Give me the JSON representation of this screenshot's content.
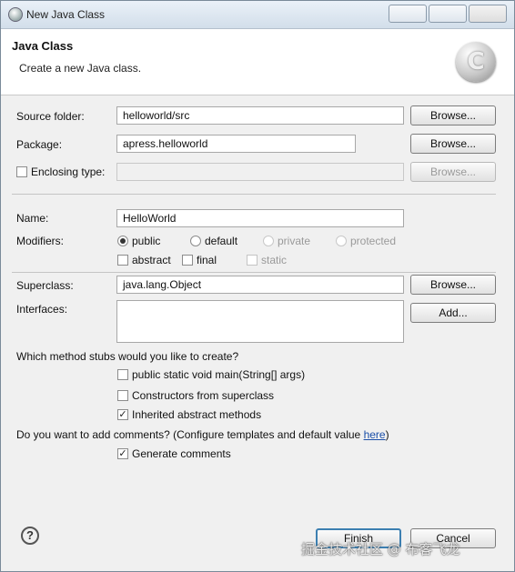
{
  "window": {
    "title": "New Java Class"
  },
  "header": {
    "title": "Java Class",
    "description": "Create a new Java class."
  },
  "source_folder": {
    "label": "Source folder:",
    "value": "helloworld/src",
    "browse_label": "Browse..."
  },
  "package": {
    "label": "Package:",
    "value": "apress.helloworld",
    "browse_label": "Browse..."
  },
  "enclosing": {
    "label": "Enclosing type:",
    "checked": false,
    "value": "",
    "browse_label": "Browse..."
  },
  "name": {
    "label": "Name:",
    "value": "HelloWorld"
  },
  "modifiers": {
    "label": "Modifiers:",
    "access": [
      "public",
      "default",
      "private",
      "protected"
    ],
    "selected": "public",
    "extra": [
      {
        "label": "abstract",
        "checked": false
      },
      {
        "label": "final",
        "checked": false
      },
      {
        "label": "static",
        "checked": false
      }
    ]
  },
  "superclass": {
    "label": "Superclass:",
    "value": "java.lang.Object",
    "browse_label": "Browse..."
  },
  "interfaces": {
    "label": "Interfaces:",
    "add_label": "Add..."
  },
  "stubs": {
    "question": "Which method stubs would you like to create?",
    "options": [
      {
        "label": "public static void main(String[] args)",
        "checked": false
      },
      {
        "label": "Constructors from superclass",
        "checked": false
      },
      {
        "label": "Inherited abstract methods",
        "checked": true
      }
    ]
  },
  "comments": {
    "question": "Do you want to add comments? (Configure templates and default value ",
    "link": "here",
    "question_end": ")",
    "generate_label": "Generate comments",
    "generate_checked": true
  },
  "footer": {
    "help_symbol": "?",
    "finish_label": "Finish",
    "cancel_label": "Cancel"
  },
  "watermark": "掘金技术社区 @ 布客飞龙"
}
